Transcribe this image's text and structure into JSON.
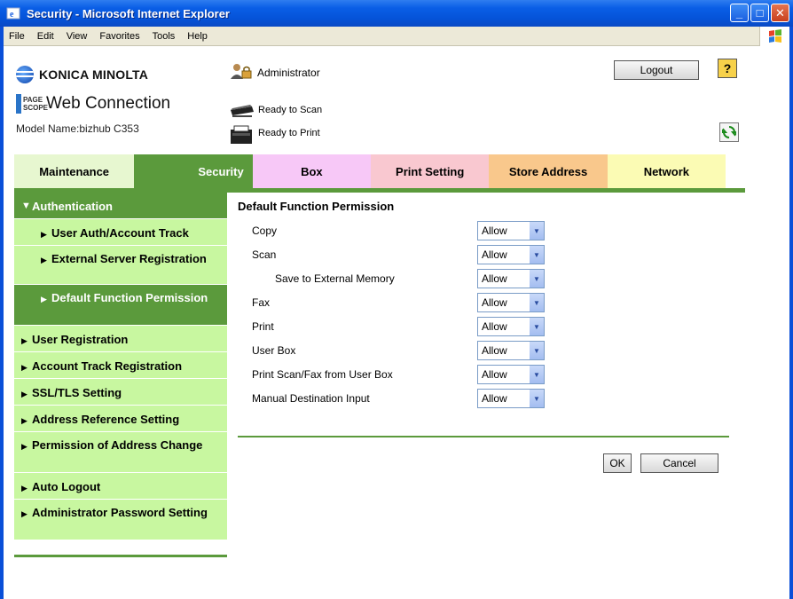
{
  "window": {
    "title": "Security - Microsoft Internet Explorer",
    "minimize": "_",
    "maximize": "□",
    "close": "✕"
  },
  "menubar": {
    "items": [
      {
        "label": "File"
      },
      {
        "label": "Edit"
      },
      {
        "label": "View"
      },
      {
        "label": "Favorites"
      },
      {
        "label": "Tools"
      },
      {
        "label": "Help"
      }
    ]
  },
  "header": {
    "brand": "KONICA MINOLTA",
    "product_badge_line1": "PAGE",
    "product_badge_line2": "SCOPE",
    "product": "Web Connection",
    "model_name": "Model Name:bizhub C353",
    "user": "Administrator",
    "scan_status": "Ready to Scan",
    "print_status": "Ready to Print",
    "logout_label": "Logout",
    "help_label": "?"
  },
  "tabs": [
    {
      "label": "Maintenance",
      "color": "#e7f7d0",
      "text_color": "#000000"
    },
    {
      "label": "Security",
      "color": "#5b9a3c",
      "text_color": "#ffffff"
    },
    {
      "label": "Box",
      "color": "#f7c8f7",
      "text_color": "#000000"
    },
    {
      "label": "Print Setting",
      "color": "#f9c8d0",
      "text_color": "#000000"
    },
    {
      "label": "Store Address",
      "color": "#f9c88c",
      "text_color": "#000000"
    },
    {
      "label": "Network",
      "color": "#fbfbb4",
      "text_color": "#000000"
    }
  ],
  "sidebar": {
    "items": [
      {
        "label": "Authentication",
        "level": 0,
        "expanded": true,
        "style": "section"
      },
      {
        "label": "User Auth/Account Track",
        "level": 1,
        "style": "sub"
      },
      {
        "label": "External Server Registration",
        "level": 1,
        "style": "sub"
      },
      {
        "label": "Default Function Permission",
        "level": 1,
        "style": "active"
      },
      {
        "label": "User Registration",
        "level": 0,
        "style": "item"
      },
      {
        "label": "Account Track Registration",
        "level": 0,
        "style": "item"
      },
      {
        "label": "SSL/TLS Setting",
        "level": 0,
        "style": "item"
      },
      {
        "label": "Address Reference Setting",
        "level": 0,
        "style": "item"
      },
      {
        "label": "Permission of Address Change",
        "level": 0,
        "style": "item"
      },
      {
        "label": "Auto Logout",
        "level": 0,
        "style": "item"
      },
      {
        "label": "Administrator Password Setting",
        "level": 0,
        "style": "item"
      }
    ]
  },
  "main": {
    "title": "Default Function Permission",
    "rows": [
      {
        "label": "Copy",
        "value": "Allow",
        "indent": false
      },
      {
        "label": "Scan",
        "value": "Allow",
        "indent": false
      },
      {
        "label": "Save to External Memory",
        "value": "Allow",
        "indent": true
      },
      {
        "label": "Fax",
        "value": "Allow",
        "indent": false
      },
      {
        "label": "Print",
        "value": "Allow",
        "indent": false
      },
      {
        "label": "User Box",
        "value": "Allow",
        "indent": false
      },
      {
        "label": "Print Scan/Fax from User Box",
        "value": "Allow",
        "indent": false
      },
      {
        "label": "Manual Destination Input",
        "value": "Allow",
        "indent": false
      }
    ],
    "ok_label": "OK",
    "cancel_label": "Cancel"
  },
  "colors": {
    "accent_green": "#5b9a3c",
    "sidebar_light": "#c8f7a0",
    "sidebar_dark": "#5b9a3c"
  }
}
